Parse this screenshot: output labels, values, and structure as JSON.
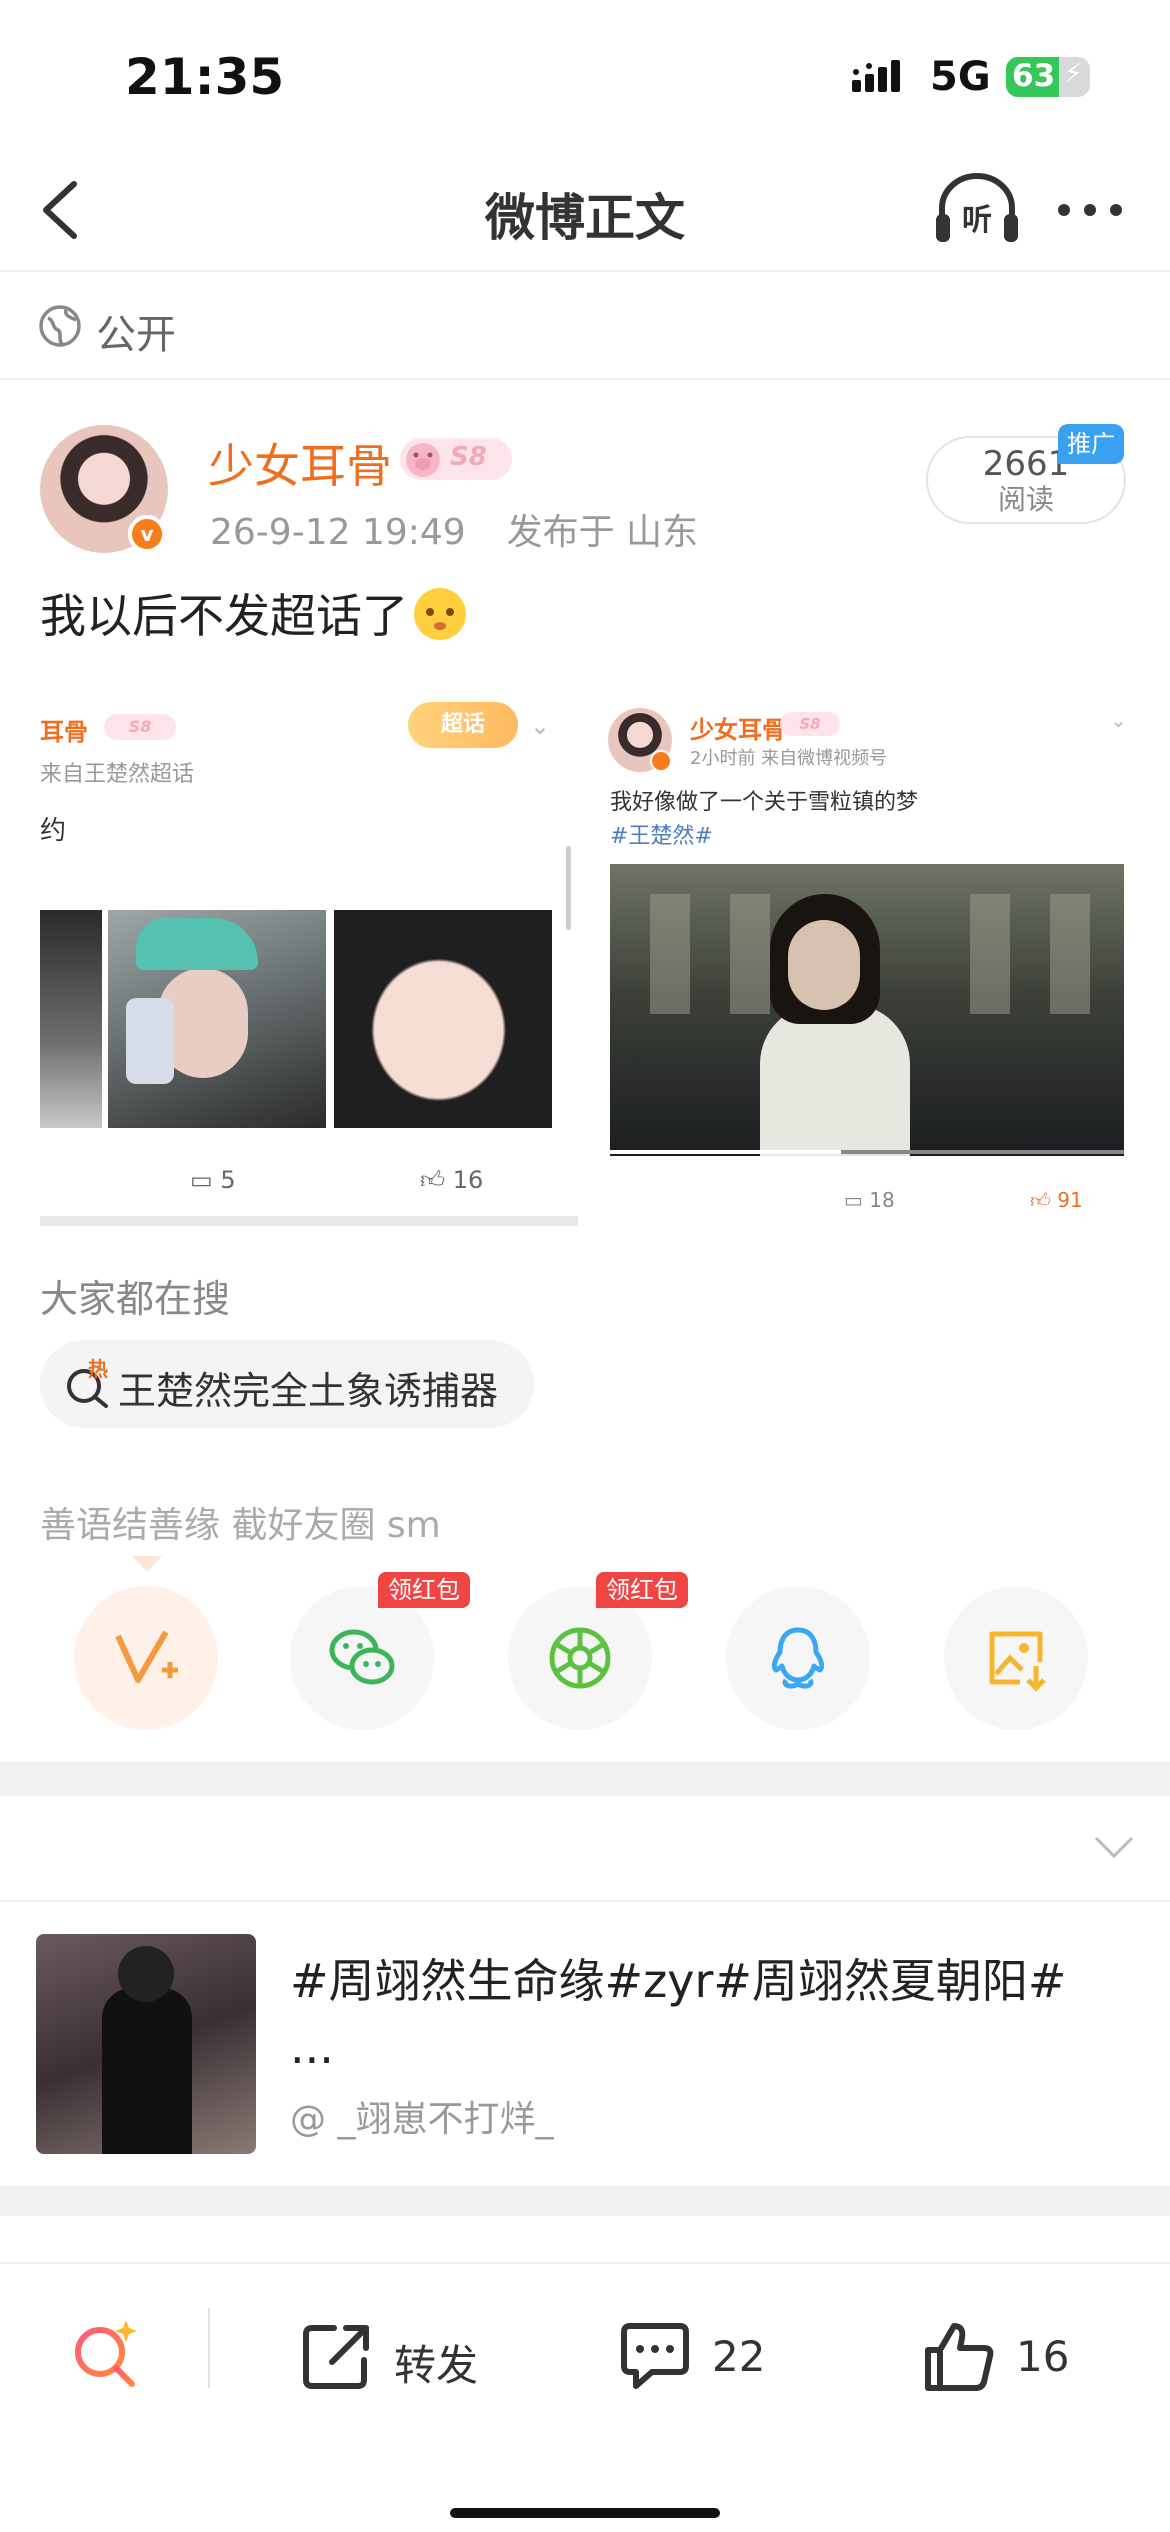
{
  "status_bar": {
    "time": "21:35",
    "network": "5G",
    "battery": "63",
    "battery_level": 0.63
  },
  "nav": {
    "title": "微博正文",
    "listen_label": "听"
  },
  "privacy": {
    "label": "公开"
  },
  "post": {
    "username": "少女耳骨",
    "level": "S8",
    "time": "26-9-12 19:49",
    "location": "发布于 山东",
    "read_count": "2661",
    "read_label": "阅读",
    "promo_tag": "推广",
    "text": "我以后不发超话了"
  },
  "card_left": {
    "name": "耳骨",
    "badge": "S8",
    "source": "来自王楚然超话",
    "tag": "超话",
    "text": "约",
    "comments": "5",
    "likes": "16"
  },
  "card_right": {
    "name": "少女耳骨",
    "badge": "S8",
    "meta": "2小时前  来自微博视频号",
    "text": "我好像做了一个关于雪粒镇的梦",
    "hashtag": "#王楚然#",
    "comments": "18",
    "likes": "91",
    "progress": 0.45
  },
  "search": {
    "title": "大家都在搜",
    "hot_tag": "热",
    "chip": "王楚然完全土象诱捕器"
  },
  "share": {
    "title": "善语结善缘 截好友圈 sm",
    "items": [
      {
        "icon": "weibo-forward-icon"
      },
      {
        "icon": "wechat-icon",
        "badge": "领红包"
      },
      {
        "icon": "moments-icon",
        "badge": "领红包"
      },
      {
        "icon": "qq-icon"
      },
      {
        "icon": "save-image-icon"
      }
    ]
  },
  "recommend": {
    "title": "#周翊然生命缘#zyr#周翊然夏朝阳# ...",
    "author": "@ _翊崽不打烊_"
  },
  "bottom_bar": {
    "repost_label": "转发",
    "comment_count": "22",
    "like_count": "16"
  },
  "colors": {
    "accent": "#f06e1f",
    "link": "#4f7dbf",
    "redpacket": "#f04545"
  }
}
